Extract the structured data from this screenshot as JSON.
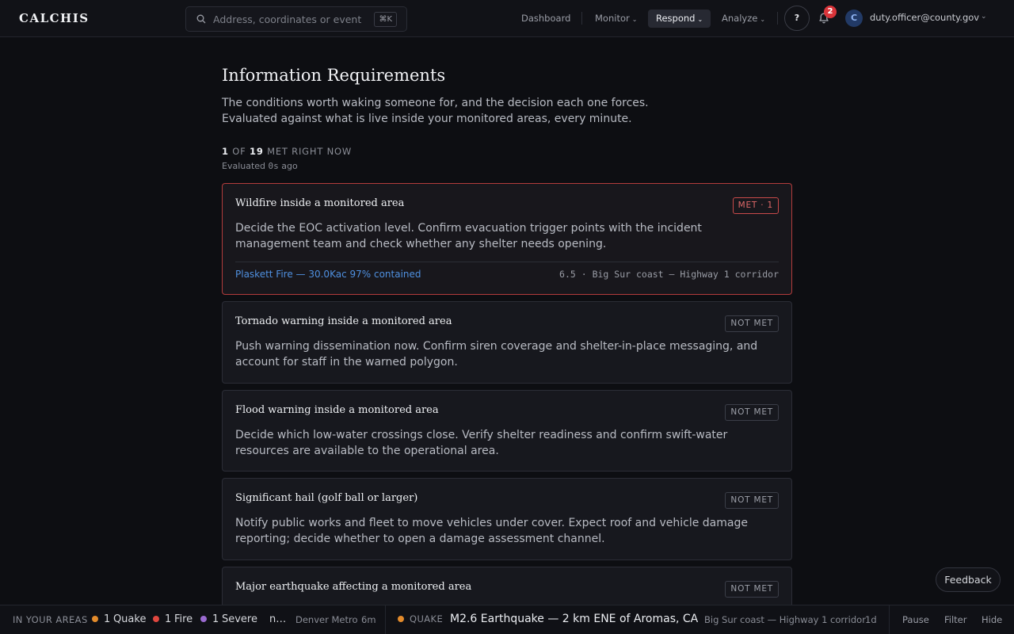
{
  "app": {
    "logo": "CALCHIS"
  },
  "search": {
    "placeholder": "Address, coordinates or event",
    "shortcut": "⌘K"
  },
  "nav": {
    "dashboard": "Dashboard",
    "monitor": "Monitor",
    "respond": "Respond",
    "analyze": "Analyze",
    "chevron": "⌄"
  },
  "header": {
    "help": "?",
    "notifications_count": "2",
    "avatar_initial": "C",
    "user_email": "duty.officer@county.gov",
    "user_chevron": "⌄"
  },
  "page": {
    "title": "Information Requirements",
    "subtitle_line1": "The conditions worth waking someone for, and the decision each one forces.",
    "subtitle_line2": "Evaluated against what is live inside your monitored areas, every minute.",
    "met_count": "1",
    "met_of": "OF",
    "total_count": "19",
    "met_suffix": "MET RIGHT NOW",
    "evaluated_prefix": "Evaluated",
    "evaluated_value": "0s",
    "evaluated_suffix": "ago"
  },
  "requirements": [
    {
      "title": "Wildfire inside a monitored area",
      "status": "MET · 1",
      "description": "Decide the EOC activation level. Confirm evacuation trigger points with the incident management team and check whether any shelter needs opening.",
      "link": "Plaskett Fire — 30.0Kac 97% contained",
      "meta": "6.5 · Big Sur coast — Highway 1 corridor"
    },
    {
      "title": "Tornado warning inside a monitored area",
      "status": "NOT MET",
      "description": "Push warning dissemination now. Confirm siren coverage and shelter-in-place messaging, and account for staff in the warned polygon."
    },
    {
      "title": "Flood warning inside a monitored area",
      "status": "NOT MET",
      "description": "Decide which low-water crossings close. Verify shelter readiness and confirm swift-water resources are available to the operational area."
    },
    {
      "title": "Significant hail (golf ball or larger)",
      "status": "NOT MET",
      "description": "Notify public works and fleet to move vehicles under cover. Expect roof and vehicle damage reporting; decide whether to open a damage assessment channel."
    },
    {
      "title": "Major earthquake affecting a monitored area",
      "status": "NOT MET"
    }
  ],
  "feedback": {
    "label": "Feedback"
  },
  "ticker": {
    "label": "IN YOUR AREAS",
    "quake_count": "1",
    "quake_label": "Quake",
    "fire_count": "1",
    "fire_label": "Fire",
    "severe_count": "1",
    "severe_label": "Severe",
    "truncated": "n…",
    "prev_area": "Denver Metro",
    "prev_age": "6m",
    "event_type": "QUAKE",
    "event_headline": "M2.6 Earthquake — 2 km ENE of Aromas, CA",
    "event_area": "Big Sur coast — Highway 1 corridor",
    "event_age": "1d",
    "pause": "Pause",
    "filter": "Filter",
    "hide": "Hide"
  },
  "colors": {
    "quake": "#e38b2b",
    "fire": "#e0473f",
    "severe": "#9a6ad0",
    "met": "#c94a4a",
    "link": "#4f90e0"
  }
}
